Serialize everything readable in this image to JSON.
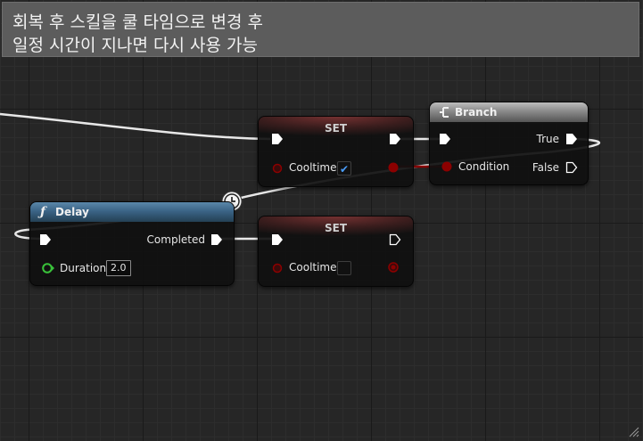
{
  "comment": {
    "text": "회복 후 스킬을 쿨 타임으로 변경 후\n일정 시간이 지나면 다시 사용 가능"
  },
  "nodes": {
    "set_true": {
      "title": "SET",
      "var_label": "Cooltime",
      "checked": true
    },
    "branch": {
      "title": "Branch",
      "condition_label": "Condition",
      "true_label": "True",
      "false_label": "False"
    },
    "delay": {
      "title": "Delay",
      "completed_label": "Completed",
      "duration_label": "Duration",
      "duration_value": "2.0"
    },
    "set_false": {
      "title": "SET",
      "var_label": "Cooltime",
      "checked": false
    }
  },
  "colors": {
    "exec_wire": "#e8e8e8",
    "bool_pin": "#8c0000",
    "float_pin": "#39c23a",
    "check_accent": "#4a9eff"
  },
  "icons": {
    "reroute": "clock-icon",
    "branch": "branch-icon",
    "delay": "function-icon"
  }
}
